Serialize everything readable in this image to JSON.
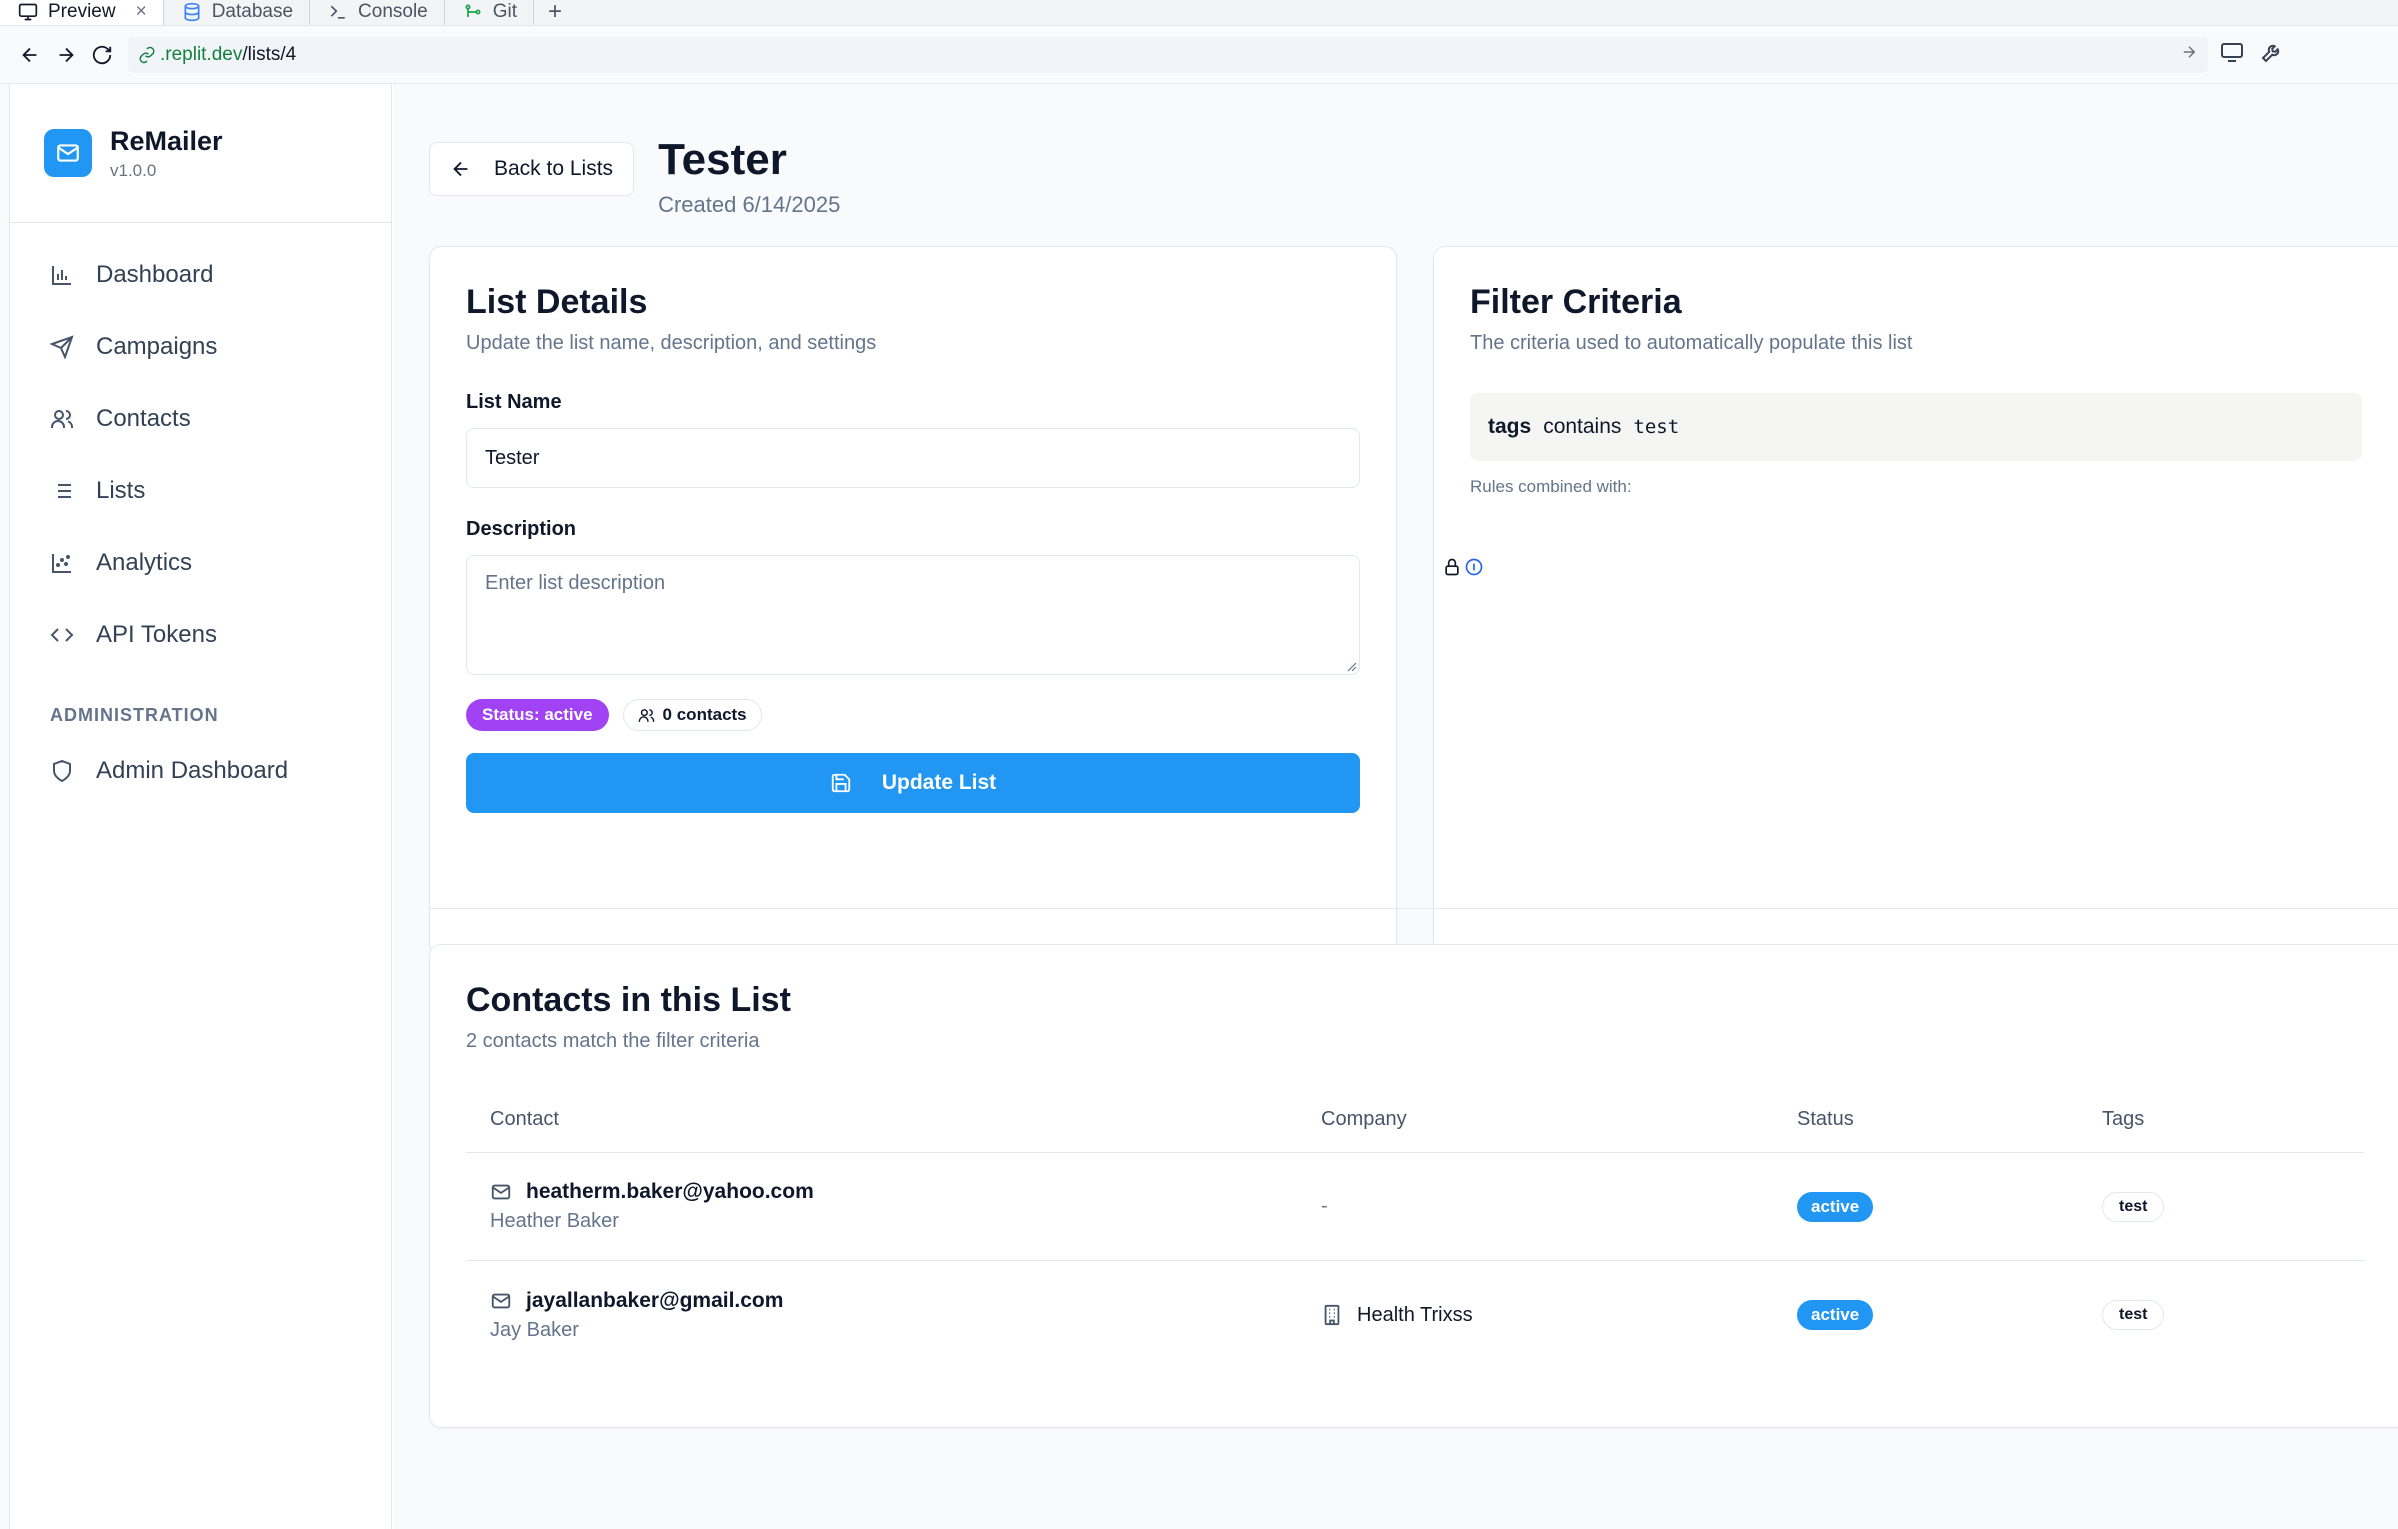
{
  "browser": {
    "tabs": [
      {
        "label": "Preview",
        "icon": "monitor-icon",
        "active": true
      },
      {
        "label": "Database",
        "icon": "database-icon"
      },
      {
        "label": "Console",
        "icon": "terminal-icon"
      },
      {
        "label": "Git",
        "icon": "git-icon"
      }
    ],
    "close_label": "×",
    "new_tab_label": "+",
    "url_host": ".replit.dev",
    "url_path": "/lists/4"
  },
  "app": {
    "name": "ReMailer",
    "version": "v1.0.0"
  },
  "sidebar": {
    "items": [
      {
        "label": "Dashboard",
        "icon": "bar-chart-icon"
      },
      {
        "label": "Campaigns",
        "icon": "send-icon"
      },
      {
        "label": "Contacts",
        "icon": "users-icon"
      },
      {
        "label": "Lists",
        "icon": "list-icon"
      },
      {
        "label": "Analytics",
        "icon": "scatter-chart-icon"
      },
      {
        "label": "API Tokens",
        "icon": "code-icon"
      }
    ],
    "section_label": "ADMINISTRATION",
    "admin_items": [
      {
        "label": "Admin Dashboard",
        "icon": "shield-icon"
      }
    ]
  },
  "header": {
    "back_label": "Back to Lists",
    "title": "Tester",
    "subtitle": "Created 6/14/2025"
  },
  "list_details": {
    "title": "List Details",
    "description": "Update the list name, description, and settings",
    "name_label": "List Name",
    "name_value": "Tester",
    "description_label": "Description",
    "description_placeholder": "Enter list description",
    "status_badge": "Status: active",
    "contacts_badge": "0 contacts",
    "update_button": "Update List"
  },
  "filter_criteria": {
    "title": "Filter Criteria",
    "description": "The criteria used to automatically populate this list",
    "rule": {
      "field": "tags",
      "operator": "contains",
      "value": "test"
    },
    "combined_label": "Rules combined with:"
  },
  "contacts": {
    "title": "Contacts in this List",
    "description": "2 contacts match the filter criteria",
    "columns": [
      "Contact",
      "Company",
      "Status",
      "Tags"
    ],
    "rows": [
      {
        "email": "heatherm.baker@yahoo.com",
        "name": "Heather Baker",
        "company": "-",
        "status": "active",
        "tag": "test"
      },
      {
        "email": "jayallanbaker@gmail.com",
        "name": "Jay Baker",
        "company": "Health Trixss",
        "status": "active",
        "tag": "test"
      }
    ]
  },
  "colors": {
    "primary": "#2196f3",
    "status_purple": "#a142f4"
  }
}
